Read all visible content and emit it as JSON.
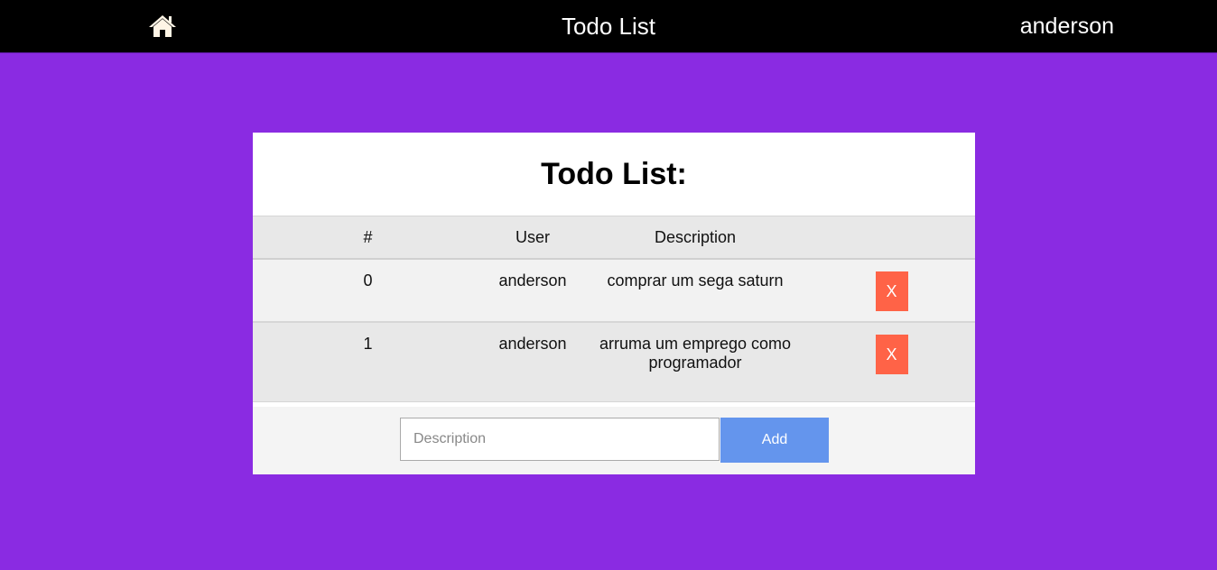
{
  "header": {
    "home_icon": "home-icon",
    "title": "Todo List",
    "username": "anderson"
  },
  "card": {
    "title": "Todo List:",
    "columns": [
      "#",
      "User",
      "Description",
      ""
    ],
    "todos": [
      {
        "id": "0",
        "user": "anderson",
        "description": "comprar um sega saturn",
        "delete_label": "X"
      },
      {
        "id": "1",
        "user": "anderson",
        "description": "arruma um emprego como programador",
        "delete_label": "X"
      }
    ],
    "input_placeholder": "Description",
    "add_label": "Add"
  },
  "colors": {
    "background": "#8a2be2",
    "topbar": "#000000",
    "delete_button": "#ff6347",
    "add_button": "#6495ed"
  }
}
